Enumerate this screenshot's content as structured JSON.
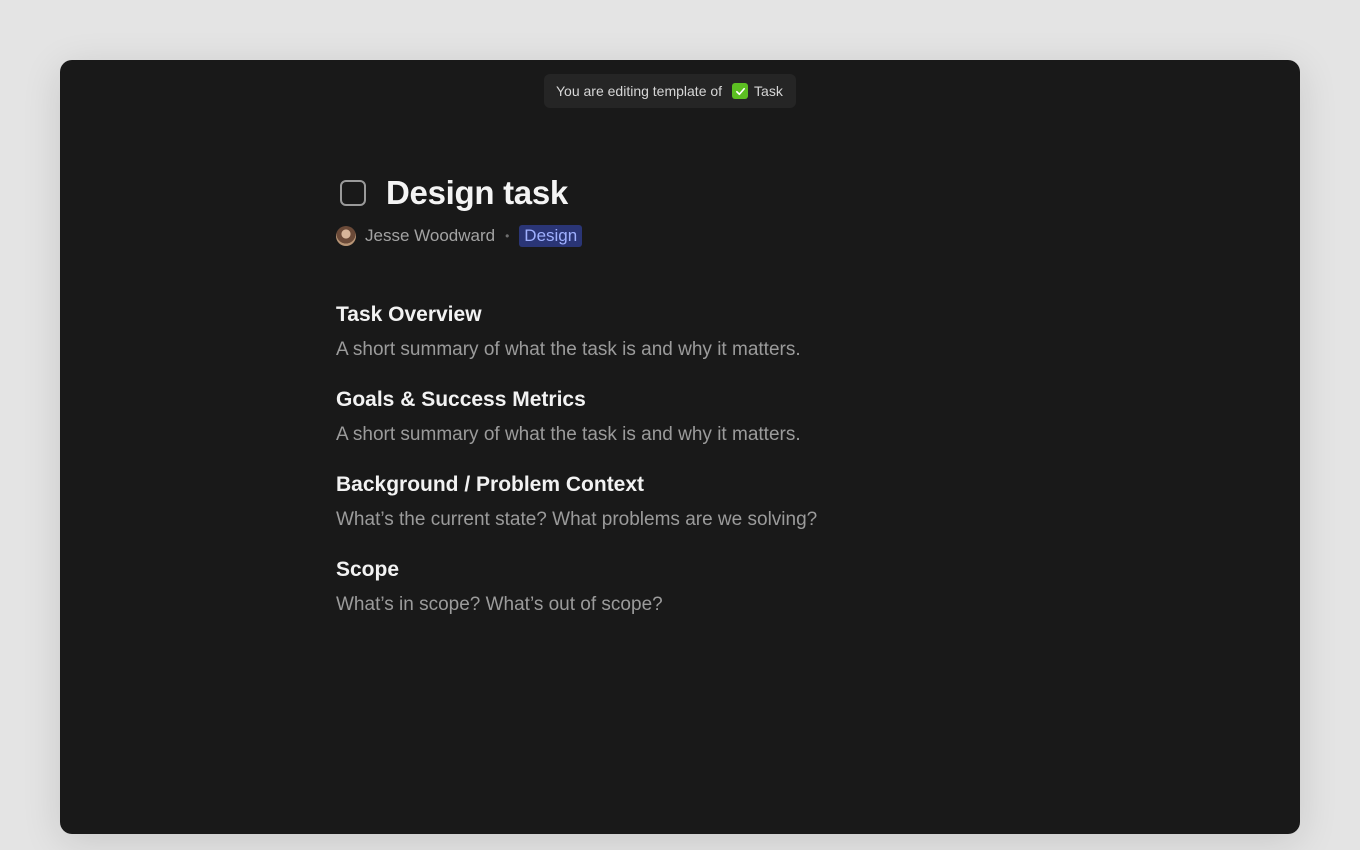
{
  "banner": {
    "prefix": "You are editing template of",
    "template_name": "Task",
    "template_icon": "green-checkbox-icon",
    "icon_color": "#5cbf22"
  },
  "document": {
    "title": "Design task",
    "author": "Jesse Woodward",
    "separator": "•",
    "tag": "Design",
    "tag_color": "#2a3576",
    "sections": [
      {
        "heading": "Task Overview",
        "body": "A short summary of what the task is and why it matters."
      },
      {
        "heading": "Goals & Success Metrics",
        "body": "A short summary of what the task is and why it matters."
      },
      {
        "heading": "Background / Problem Context",
        "body": "What’s the current state? What problems are we solving?"
      },
      {
        "heading": "Scope",
        "body": "What’s in scope? What’s out of scope?"
      }
    ]
  }
}
